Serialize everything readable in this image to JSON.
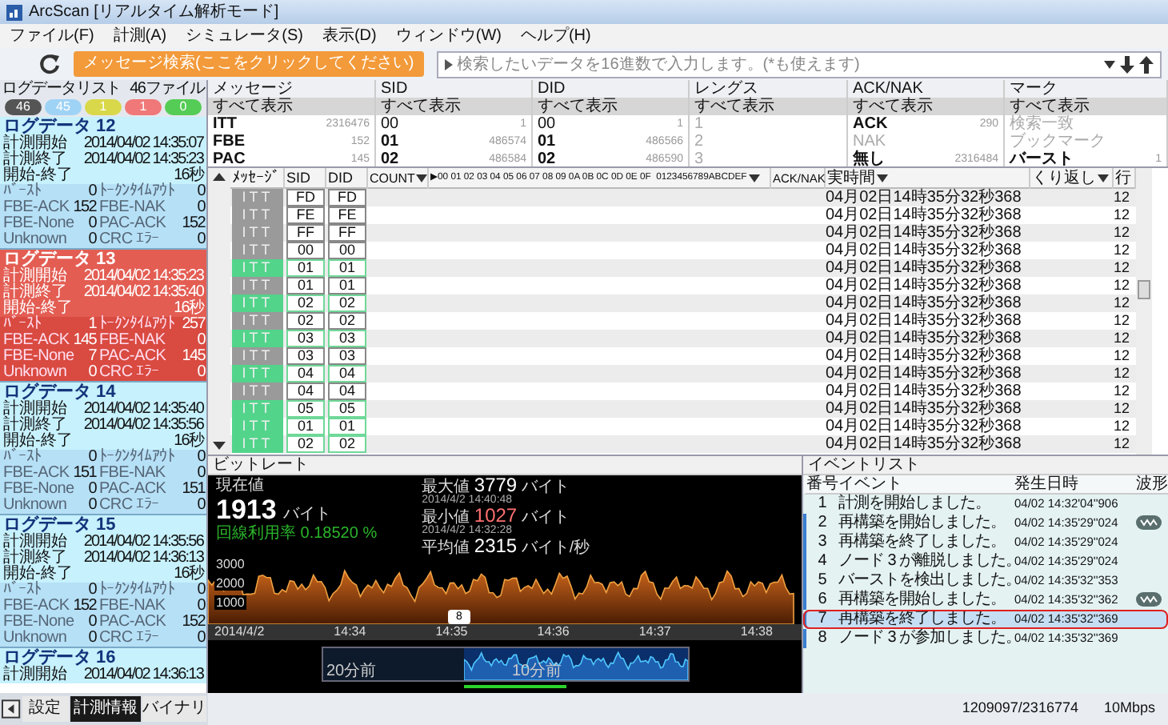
{
  "window": {
    "title": "ArcScan [リアルタイム解析モード]"
  },
  "menu": [
    "ファイル(F)",
    "計測(A)",
    "シミュレータ(S)",
    "表示(D)",
    "ウィンドウ(W)",
    "ヘルプ(H)"
  ],
  "toolbar": {
    "search_button": "メッセージ検索(ここをクリックしてください)",
    "search": {
      "placeholder": "検索したいデータを16進数で入力します。(*も使えます)"
    }
  },
  "log_list": {
    "title": "ログデータリスト",
    "file_count": "46ファイル",
    "counters": [
      {
        "value": "46",
        "color": "#555555"
      },
      {
        "value": "45",
        "color": "#9fd3f5"
      },
      {
        "value": "1",
        "color": "#d8d84a"
      },
      {
        "value": "1",
        "color": "#f07878"
      },
      {
        "value": "0",
        "color": "#55cc55"
      }
    ],
    "logs": [
      {
        "title": "ログデータ 12",
        "selected": false,
        "times": [
          {
            "label": "計測開始",
            "value": "2014/04/02 14:35:07"
          },
          {
            "label": "計測終了",
            "value": "2014/04/02 14:35:23"
          },
          {
            "label": "開始-終了",
            "value": "16秒"
          }
        ],
        "stats": [
          {
            "label": "ﾊﾞｰｽﾄ",
            "value": "0"
          },
          {
            "label": "ﾄｰｸﾝﾀｲﾑｱｳﾄ",
            "value": "0"
          },
          {
            "label": "FBE-ACK",
            "value": "152"
          },
          {
            "label": "FBE-NAK",
            "value": "0"
          },
          {
            "label": "FBE-None",
            "value": "0"
          },
          {
            "label": "PAC-ACK",
            "value": "152"
          },
          {
            "label": "Unknown",
            "value": "0"
          },
          {
            "label": "CRC ｴﾗｰ",
            "value": "0"
          }
        ]
      },
      {
        "title": "ログデータ 13",
        "selected": true,
        "times": [
          {
            "label": "計測開始",
            "value": "2014/04/02 14:35:23"
          },
          {
            "label": "計測終了",
            "value": "2014/04/02 14:35:40"
          },
          {
            "label": "開始-終了",
            "value": "16秒"
          }
        ],
        "stats": [
          {
            "label": "ﾊﾞｰｽﾄ",
            "value": "1"
          },
          {
            "label": "ﾄｰｸﾝﾀｲﾑｱｳﾄ",
            "value": "257"
          },
          {
            "label": "FBE-ACK",
            "value": "145"
          },
          {
            "label": "FBE-NAK",
            "value": "0"
          },
          {
            "label": "FBE-None",
            "value": "7"
          },
          {
            "label": "PAC-ACK",
            "value": "145"
          },
          {
            "label": "Unknown",
            "value": "0"
          },
          {
            "label": "CRC ｴﾗｰ",
            "value": "0"
          }
        ]
      },
      {
        "title": "ログデータ 14",
        "selected": false,
        "times": [
          {
            "label": "計測開始",
            "value": "2014/04/02 14:35:40"
          },
          {
            "label": "計測終了",
            "value": "2014/04/02 14:35:56"
          },
          {
            "label": "開始-終了",
            "value": "16秒"
          }
        ],
        "stats": [
          {
            "label": "ﾊﾞｰｽﾄ",
            "value": "0"
          },
          {
            "label": "ﾄｰｸﾝﾀｲﾑｱｳﾄ",
            "value": "0"
          },
          {
            "label": "FBE-ACK",
            "value": "151"
          },
          {
            "label": "FBE-NAK",
            "value": "0"
          },
          {
            "label": "FBE-None",
            "value": "0"
          },
          {
            "label": "PAC-ACK",
            "value": "151"
          },
          {
            "label": "Unknown",
            "value": "0"
          },
          {
            "label": "CRC ｴﾗｰ",
            "value": "0"
          }
        ]
      },
      {
        "title": "ログデータ 15",
        "selected": false,
        "times": [
          {
            "label": "計測開始",
            "value": "2014/04/02 14:35:56"
          },
          {
            "label": "計測終了",
            "value": "2014/04/02 14:36:13"
          },
          {
            "label": "開始-終了",
            "value": "16秒"
          }
        ],
        "stats": [
          {
            "label": "ﾊﾞｰｽﾄ",
            "value": "0"
          },
          {
            "label": "ﾄｰｸﾝﾀｲﾑｱｳﾄ",
            "value": "0"
          },
          {
            "label": "FBE-ACK",
            "value": "152"
          },
          {
            "label": "FBE-NAK",
            "value": "0"
          },
          {
            "label": "FBE-None",
            "value": "0"
          },
          {
            "label": "PAC-ACK",
            "value": "152"
          },
          {
            "label": "Unknown",
            "value": "0"
          },
          {
            "label": "CRC ｴﾗｰ",
            "value": "0"
          }
        ]
      },
      {
        "title": "ログデータ 16",
        "selected": false,
        "times": [
          {
            "label": "計測開始",
            "value": "2014/04/02 14:36:13"
          }
        ]
      }
    ]
  },
  "filters": [
    {
      "title": "メッセージ",
      "all": "すべて表示",
      "items": [
        {
          "label": "ITT",
          "count": "2316476",
          "kind": "bold"
        },
        {
          "label": "FBE",
          "count": "152",
          "kind": "bold"
        },
        {
          "label": "PAC",
          "count": "145",
          "kind": "bold"
        }
      ]
    },
    {
      "title": "SID",
      "all": "すべて表示",
      "items": [
        {
          "label": "00",
          "count": "1",
          "kind": "normal"
        },
        {
          "label": "01",
          "count": "486574",
          "kind": "bold"
        },
        {
          "label": "02",
          "count": "486584",
          "kind": "bold"
        }
      ]
    },
    {
      "title": "DID",
      "all": "すべて表示",
      "items": [
        {
          "label": "00",
          "count": "1",
          "kind": "normal"
        },
        {
          "label": "01",
          "count": "486566",
          "kind": "bold"
        },
        {
          "label": "02",
          "count": "486590",
          "kind": "bold"
        }
      ]
    },
    {
      "title": "レングス",
      "all": "すべて表示",
      "items": [
        {
          "label": "1",
          "kind": "dim"
        },
        {
          "label": "2",
          "kind": "dim"
        },
        {
          "label": "3",
          "kind": "dim"
        }
      ]
    },
    {
      "title": "ACK/NAK",
      "all": "すべて表示",
      "items": [
        {
          "label": "ACK",
          "count": "290",
          "kind": "bold"
        },
        {
          "label": "NAK",
          "kind": "dim"
        },
        {
          "label": "無し",
          "count": "2316484",
          "kind": "bold"
        }
      ]
    },
    {
      "title": "マーク",
      "all": "すべて表示",
      "items": [
        {
          "label": "検索一致",
          "kind": "dim"
        },
        {
          "label": "ブックマーク",
          "kind": "dim"
        },
        {
          "label": "バースト",
          "count": "1",
          "kind": "bold"
        }
      ]
    }
  ],
  "table": {
    "columns": [
      {
        "label": "ﾒｯｾｰｼﾞ"
      },
      {
        "label": "SID"
      },
      {
        "label": "DID"
      },
      {
        "label": "COUNT",
        "dropdown": true
      },
      {
        "label": "▶00 01 02 03 04 05 06 07 08 09 0A 0B 0C 0D 0E 0F  0123456789ABCDEF",
        "dropdown": true
      },
      {
        "label": "ACK/NAK"
      },
      {
        "label": "実時間",
        "dropdown": true
      },
      {
        "label": "くり返し",
        "dropdown": true
      },
      {
        "label": "行"
      }
    ],
    "rows": [
      {
        "message": "ITT",
        "highlight": false,
        "sid": "FD",
        "did": "FD",
        "time": "04月02日14時35分32秒368",
        "line": "12"
      },
      {
        "message": "ITT",
        "highlight": false,
        "sid": "FE",
        "did": "FE",
        "time": "04月02日14時35分32秒368",
        "line": "12"
      },
      {
        "message": "ITT",
        "highlight": false,
        "sid": "FF",
        "did": "FF",
        "time": "04月02日14時35分32秒368",
        "line": "12"
      },
      {
        "message": "ITT",
        "highlight": false,
        "sid": "00",
        "did": "00",
        "time": "04月02日14時35分32秒368",
        "line": "12"
      },
      {
        "message": "ITT",
        "highlight": true,
        "sid": "01",
        "did": "01",
        "time": "04月02日14時35分32秒368",
        "line": "12"
      },
      {
        "message": "ITT",
        "highlight": false,
        "sid": "01",
        "did": "01",
        "time": "04月02日14時35分32秒368",
        "line": "12"
      },
      {
        "message": "ITT",
        "highlight": true,
        "sid": "02",
        "did": "02",
        "time": "04月02日14時35分32秒368",
        "line": "12"
      },
      {
        "message": "ITT",
        "highlight": false,
        "sid": "02",
        "did": "02",
        "time": "04月02日14時35分32秒368",
        "line": "12"
      },
      {
        "message": "ITT",
        "highlight": true,
        "sid": "03",
        "did": "03",
        "time": "04月02日14時35分32秒368",
        "line": "12"
      },
      {
        "message": "ITT",
        "highlight": false,
        "sid": "03",
        "did": "03",
        "time": "04月02日14時35分32秒368",
        "line": "12"
      },
      {
        "message": "ITT",
        "highlight": true,
        "sid": "04",
        "did": "04",
        "time": "04月02日14時35分32秒368",
        "line": "12"
      },
      {
        "message": "ITT",
        "highlight": false,
        "sid": "04",
        "did": "04",
        "time": "04月02日14時35分32秒368",
        "line": "12"
      },
      {
        "message": "ITT",
        "highlight": true,
        "sid": "05",
        "did": "05",
        "time": "04月02日14時35分32秒368",
        "line": "12"
      },
      {
        "message": "ITT",
        "highlight": true,
        "sid": "01",
        "did": "01",
        "time": "04月02日14時35分32秒368",
        "line": "12"
      },
      {
        "message": "ITT",
        "highlight": true,
        "sid": "02",
        "did": "02",
        "time": "04月02日14時35分32秒368",
        "line": "12"
      }
    ]
  },
  "bitrate": {
    "title": "ビットレート",
    "current": {
      "label": "現在値",
      "value": "1913",
      "unit": "バイト"
    },
    "utilization": {
      "label": "回線利用率",
      "value": "0.18520 %"
    },
    "stats": [
      {
        "label": "最大値",
        "value": "3779",
        "unit": "バイト",
        "time": "2014/4/2 14:40:48",
        "kind": "max"
      },
      {
        "label": "最小値",
        "value": "1027",
        "unit": "バイト",
        "time": "2014/4/2 14:32:28",
        "kind": "min"
      },
      {
        "label": "平均値",
        "value": "2315",
        "unit": "バイト/秒",
        "kind": "avg"
      }
    ],
    "y_labels": [
      "3000",
      "2000",
      "1000"
    ],
    "x_labels": [
      "2014/4/2",
      "14:34",
      "14:35",
      "14:36",
      "14:37",
      "14:38"
    ],
    "marker": "8",
    "overview_labels": [
      "20分前",
      "10分前"
    ]
  },
  "events": {
    "title": "イベントリスト",
    "columns": [
      "番号",
      "イベント",
      "発生日時",
      "波形"
    ],
    "rows": [
      {
        "no": "1",
        "event": "計測を開始しました。",
        "time": "04/02 14:32'04''906",
        "grouped": false,
        "waveform": false,
        "selected": false
      },
      {
        "no": "2",
        "event": "再構築を開始しました。",
        "time": "04/02 14:35'29''024",
        "grouped": true,
        "waveform": true,
        "selected": false
      },
      {
        "no": "3",
        "event": "再構築を終了しました。",
        "time": "04/02 14:35'29''024",
        "grouped": true,
        "waveform": false,
        "selected": false
      },
      {
        "no": "4",
        "event": "ノード 3 が離脱しました。",
        "time": "04/02 14:35'29''024",
        "grouped": true,
        "waveform": false,
        "selected": false
      },
      {
        "no": "5",
        "event": "バーストを検出しました。",
        "time": "04/02 14:35'32''353",
        "grouped": true,
        "waveform": false,
        "selected": false
      },
      {
        "no": "6",
        "event": "再構築を開始しました。",
        "time": "04/02 14:35'32''362",
        "grouped": true,
        "waveform": true,
        "selected": false
      },
      {
        "no": "7",
        "event": "再構築を終了しました。",
        "time": "04/02 14:35'32''369",
        "grouped": true,
        "waveform": false,
        "selected": true
      },
      {
        "no": "8",
        "event": "ノード 3 が参加しました。",
        "time": "04/02 14:35'32''369",
        "grouped": true,
        "waveform": false,
        "selected": false
      }
    ]
  },
  "bottom_tabs": [
    {
      "label": "設定",
      "selected": false
    },
    {
      "label": "計測情報",
      "selected": true
    },
    {
      "label": "バイナリ",
      "selected": false
    }
  ],
  "status_bar": {
    "position": "1209097/2316774",
    "speed": "10Mbps"
  }
}
